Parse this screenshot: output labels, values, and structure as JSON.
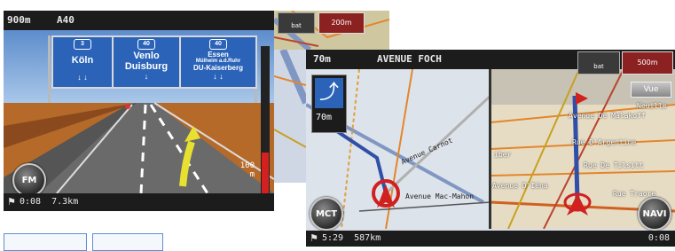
{
  "screen1": {
    "distance": "900m",
    "road": "A40",
    "signs": [
      {
        "number": "3",
        "city1": "Köln",
        "city2": "",
        "arrows": "↓ ↓"
      },
      {
        "number": "40",
        "city1": "Venlo",
        "city2": "Duisburg",
        "arrows": "↓"
      },
      {
        "number": "40",
        "city1": "Essen",
        "city2": "Mülheim a.d.Ruhr",
        "city3": "DU-Kaiserberg",
        "arrows": "↓ ↓"
      }
    ],
    "fm_button": "FM",
    "scale_value": "100",
    "scale_unit": "m",
    "status": "0:08  7.3km",
    "right_ticker": "200m",
    "right_label": "bat"
  },
  "screen2": {
    "distance": "70m",
    "street": "AVENUE FOCH",
    "turn_distance": "70m",
    "mct_button": "MCT",
    "navi_button": "NAVI",
    "vue_button": "Vue",
    "ticker_distance": "500m",
    "ticker_label": "bat",
    "status": "5:29  587km",
    "status_right": "0:08",
    "streets_left": [
      "Avenue Carnot",
      "Avenue Mac-Mahon"
    ],
    "streets_right": [
      "Avenue De Malakoff",
      "Rue D'Argentine",
      "Rue De Tilsitt",
      "Avenue D'Iéna",
      "Rue Traore",
      "Neuille",
      "iber"
    ]
  },
  "blank_tabs": [
    "",
    ""
  ]
}
